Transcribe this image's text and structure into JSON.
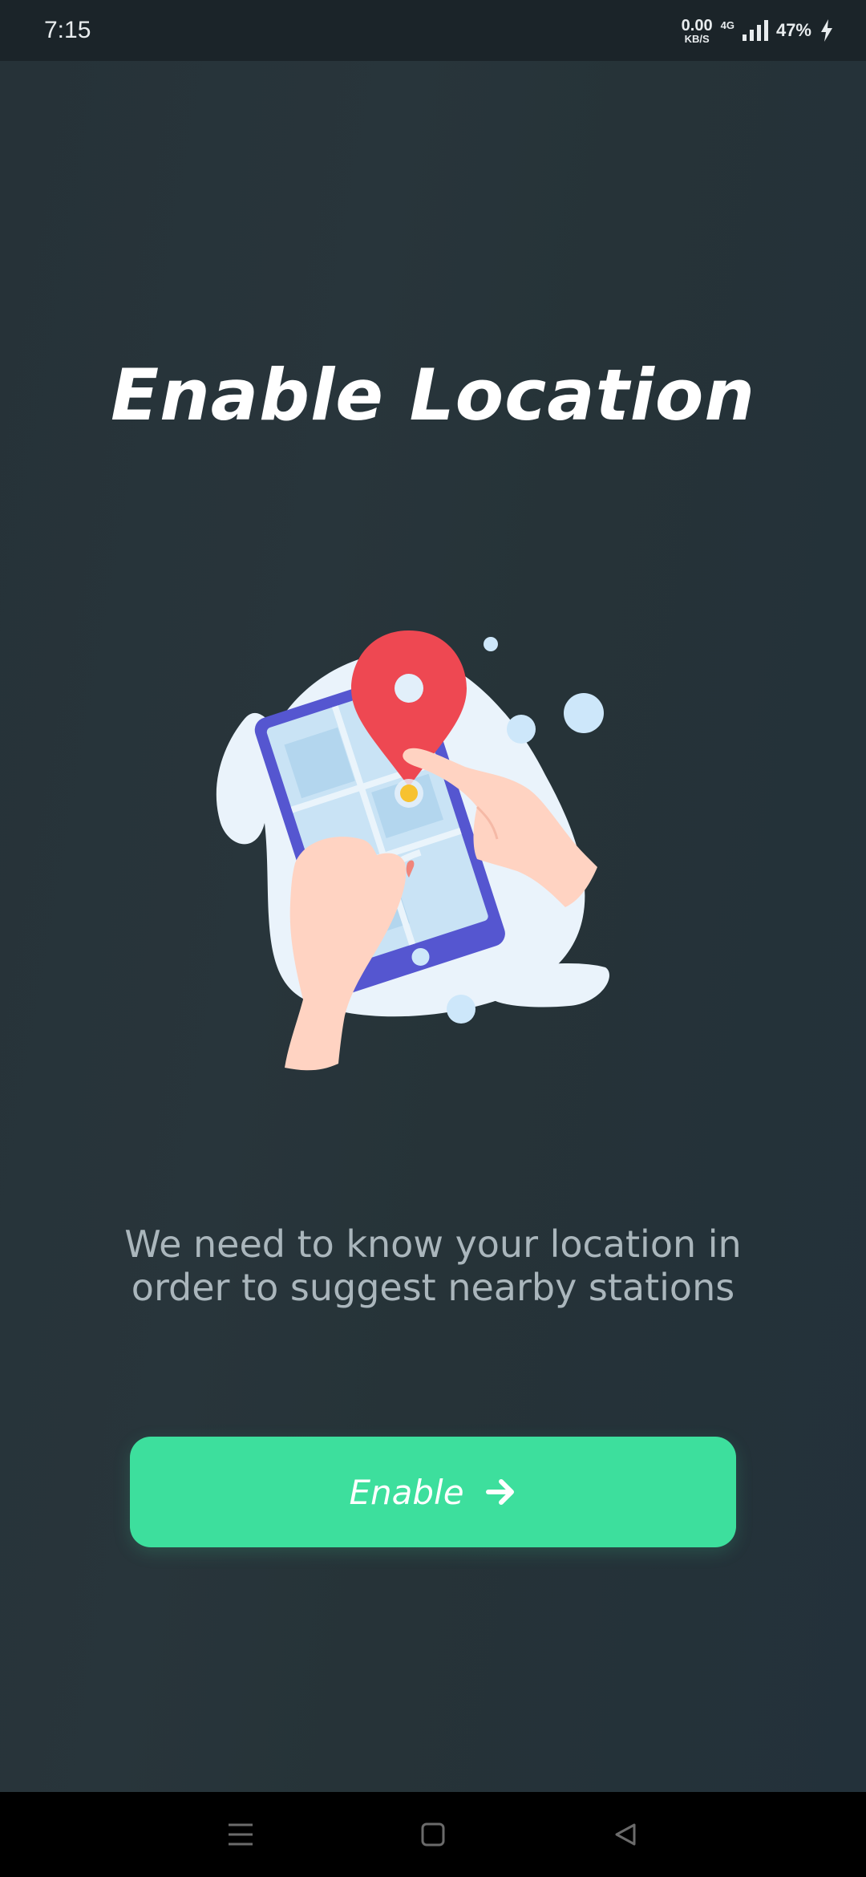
{
  "status_bar": {
    "time": "7:15",
    "net_speed_value": "0.00",
    "net_speed_unit": "KB/S",
    "network_type": "4G",
    "battery": "47%",
    "icons": [
      "signal-icon",
      "charging-bolt-icon"
    ]
  },
  "screen": {
    "title": "Enable Location",
    "description": "We need to know your location in order to suggest nearby stations",
    "illustration": "hand-pointing-location-pin-on-phone",
    "button": {
      "label": "Enable",
      "icon": "arrow-right-icon"
    }
  },
  "nav_bar": {
    "icons": [
      "menu-icon",
      "home-icon",
      "back-icon"
    ]
  },
  "colors": {
    "background": "#263238",
    "accent": "#3ddf9d",
    "pin": "#ee4852",
    "phone": "#5556d0",
    "text_muted": "#aab6bc"
  }
}
